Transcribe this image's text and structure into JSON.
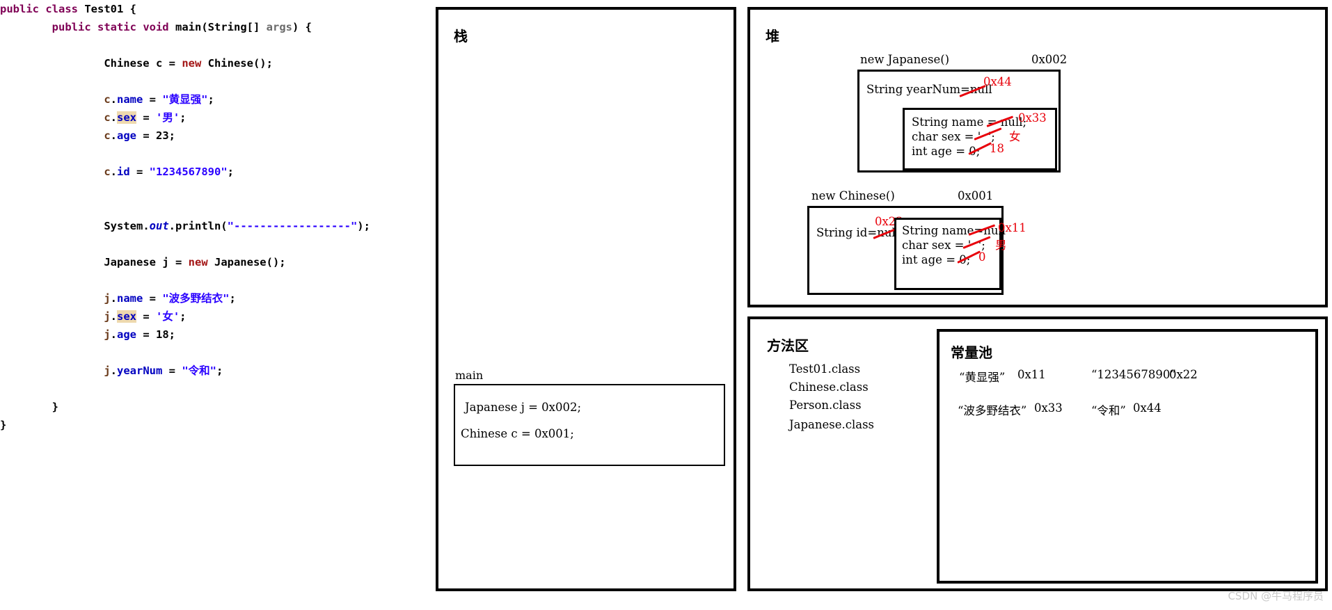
{
  "code": {
    "lines": [
      {
        "indent": 0,
        "tokens": [
          {
            "t": "public ",
            "c": "kw"
          },
          {
            "t": "class ",
            "c": "kw"
          },
          {
            "t": "Test01 {",
            "c": "plain"
          }
        ]
      },
      {
        "indent": 4,
        "tokens": [
          {
            "t": "public ",
            "c": "kw"
          },
          {
            "t": "static ",
            "c": "kw"
          },
          {
            "t": "void ",
            "c": "kw"
          },
          {
            "t": "main",
            "c": "plain"
          },
          {
            "t": "(",
            "c": "plain"
          },
          {
            "t": "String",
            "c": "plain"
          },
          {
            "t": "[] ",
            "c": "plain"
          },
          {
            "t": "args",
            "c": "gray"
          },
          {
            "t": ") {",
            "c": "plain"
          }
        ]
      },
      {
        "indent": 0,
        "tokens": []
      },
      {
        "indent": 8,
        "tokens": [
          {
            "t": "Chinese ",
            "c": "plain"
          },
          {
            "t": "c ",
            "c": "plain"
          },
          {
            "t": "= ",
            "c": "plain"
          },
          {
            "t": "new ",
            "c": "kw2"
          },
          {
            "t": "Chinese();",
            "c": "plain"
          }
        ]
      },
      {
        "indent": 0,
        "tokens": []
      },
      {
        "indent": 8,
        "tokens": [
          {
            "t": "c",
            "c": "recv"
          },
          {
            "t": ".",
            "c": "plain"
          },
          {
            "t": "name",
            "c": "fieldnm"
          },
          {
            "t": " = ",
            "c": "plain"
          },
          {
            "t": "\"黄显强\"",
            "c": "str"
          },
          {
            "t": ";",
            "c": "plain"
          }
        ]
      },
      {
        "indent": 8,
        "tokens": [
          {
            "t": "c",
            "c": "recv"
          },
          {
            "t": ".",
            "c": "plain"
          },
          {
            "t": "sex",
            "c": "fieldnm hl"
          },
          {
            "t": " = ",
            "c": "plain"
          },
          {
            "t": "'男'",
            "c": "str"
          },
          {
            "t": ";",
            "c": "plain"
          }
        ]
      },
      {
        "indent": 8,
        "tokens": [
          {
            "t": "c",
            "c": "recv"
          },
          {
            "t": ".",
            "c": "plain"
          },
          {
            "t": "age",
            "c": "fieldnm"
          },
          {
            "t": " = ",
            "c": "plain"
          },
          {
            "t": "23",
            "c": "num"
          },
          {
            "t": ";",
            "c": "plain"
          }
        ]
      },
      {
        "indent": 0,
        "tokens": []
      },
      {
        "indent": 8,
        "tokens": [
          {
            "t": "c",
            "c": "recv"
          },
          {
            "t": ".",
            "c": "plain"
          },
          {
            "t": "id",
            "c": "fieldnm"
          },
          {
            "t": " = ",
            "c": "plain"
          },
          {
            "t": "\"1234567890\"",
            "c": "str"
          },
          {
            "t": ";",
            "c": "plain"
          }
        ]
      },
      {
        "indent": 0,
        "tokens": []
      },
      {
        "indent": 0,
        "tokens": []
      },
      {
        "indent": 8,
        "tokens": [
          {
            "t": "System",
            "c": "plain"
          },
          {
            "t": ".",
            "c": "plain"
          },
          {
            "t": "out",
            "c": "staticf"
          },
          {
            "t": ".println(",
            "c": "plain"
          },
          {
            "t": "\"------------------\"",
            "c": "str"
          },
          {
            "t": ");",
            "c": "plain"
          }
        ]
      },
      {
        "indent": 0,
        "tokens": []
      },
      {
        "indent": 8,
        "tokens": [
          {
            "t": "Japanese ",
            "c": "plain"
          },
          {
            "t": "j ",
            "c": "plain"
          },
          {
            "t": "= ",
            "c": "plain"
          },
          {
            "t": "new ",
            "c": "kw2"
          },
          {
            "t": "Japanese();",
            "c": "plain"
          }
        ]
      },
      {
        "indent": 0,
        "tokens": []
      },
      {
        "indent": 8,
        "tokens": [
          {
            "t": "j",
            "c": "recv"
          },
          {
            "t": ".",
            "c": "plain"
          },
          {
            "t": "name",
            "c": "fieldnm"
          },
          {
            "t": " = ",
            "c": "plain"
          },
          {
            "t": "\"波多野结衣\"",
            "c": "str"
          },
          {
            "t": ";",
            "c": "plain"
          }
        ]
      },
      {
        "indent": 8,
        "tokens": [
          {
            "t": "j",
            "c": "recv"
          },
          {
            "t": ".",
            "c": "plain"
          },
          {
            "t": "sex",
            "c": "fieldnm hl"
          },
          {
            "t": " = ",
            "c": "plain"
          },
          {
            "t": "'女'",
            "c": "str"
          },
          {
            "t": ";",
            "c": "plain"
          }
        ]
      },
      {
        "indent": 8,
        "tokens": [
          {
            "t": "j",
            "c": "recv"
          },
          {
            "t": ".",
            "c": "plain"
          },
          {
            "t": "age",
            "c": "fieldnm"
          },
          {
            "t": " = ",
            "c": "plain"
          },
          {
            "t": "18",
            "c": "num"
          },
          {
            "t": ";",
            "c": "plain"
          }
        ]
      },
      {
        "indent": 0,
        "tokens": []
      },
      {
        "indent": 8,
        "tokens": [
          {
            "t": "j",
            "c": "recv"
          },
          {
            "t": ".",
            "c": "plain"
          },
          {
            "t": "yearNum",
            "c": "fieldnm"
          },
          {
            "t": " = ",
            "c": "plain"
          },
          {
            "t": "\"令和\"",
            "c": "str"
          },
          {
            "t": ";",
            "c": "plain"
          }
        ]
      },
      {
        "indent": 0,
        "tokens": []
      },
      {
        "indent": 4,
        "tokens": [
          {
            "t": "}",
            "c": "plain"
          }
        ]
      },
      {
        "indent": 0,
        "tokens": [
          {
            "t": "}",
            "c": "plain"
          }
        ]
      }
    ]
  },
  "diagram": {
    "stack": {
      "title": "栈",
      "frame_label": "main",
      "frame_lines": [
        "Japanese j = 0x002;",
        "Chinese c = 0x001;"
      ]
    },
    "heap": {
      "title": "堆",
      "objects": [
        {
          "caption": "new Japanese()",
          "address": "0x002",
          "outer_field": "String yearNum=null",
          "outer_annotation": "0x44",
          "inner_fields": [
            {
              "text": "String name = null;",
              "annotation": "0x33"
            },
            {
              "text": "char sex = '  ';",
              "annotation": "女"
            },
            {
              "text": "int age = 0;",
              "annotation": "18"
            }
          ]
        },
        {
          "caption": "new Chinese()",
          "address": "0x001",
          "outer_field": "String id=null",
          "outer_annotation": "0x22",
          "inner_fields": [
            {
              "text": "String name=null",
              "annotation": "0x11"
            },
            {
              "text": "char sex = '  ';",
              "annotation": "男"
            },
            {
              "text": "int age = 0;",
              "annotation": "0"
            }
          ]
        }
      ]
    },
    "method_area": {
      "title": "方法区",
      "classes": [
        "Test01.class",
        "Chinese.class",
        "Person.class",
        "Japanese.class"
      ],
      "constant_pool": {
        "title": "常量池",
        "entries": [
          {
            "literal": "“黄显强”",
            "address": "0x11"
          },
          {
            "literal": "“1234567890”",
            "address": "0x22"
          },
          {
            "literal": "“波多野结衣”",
            "address": "0x33"
          },
          {
            "literal": "“令和”",
            "address": "0x44"
          }
        ]
      }
    }
  },
  "watermark": "CSDN @牛马程序员"
}
